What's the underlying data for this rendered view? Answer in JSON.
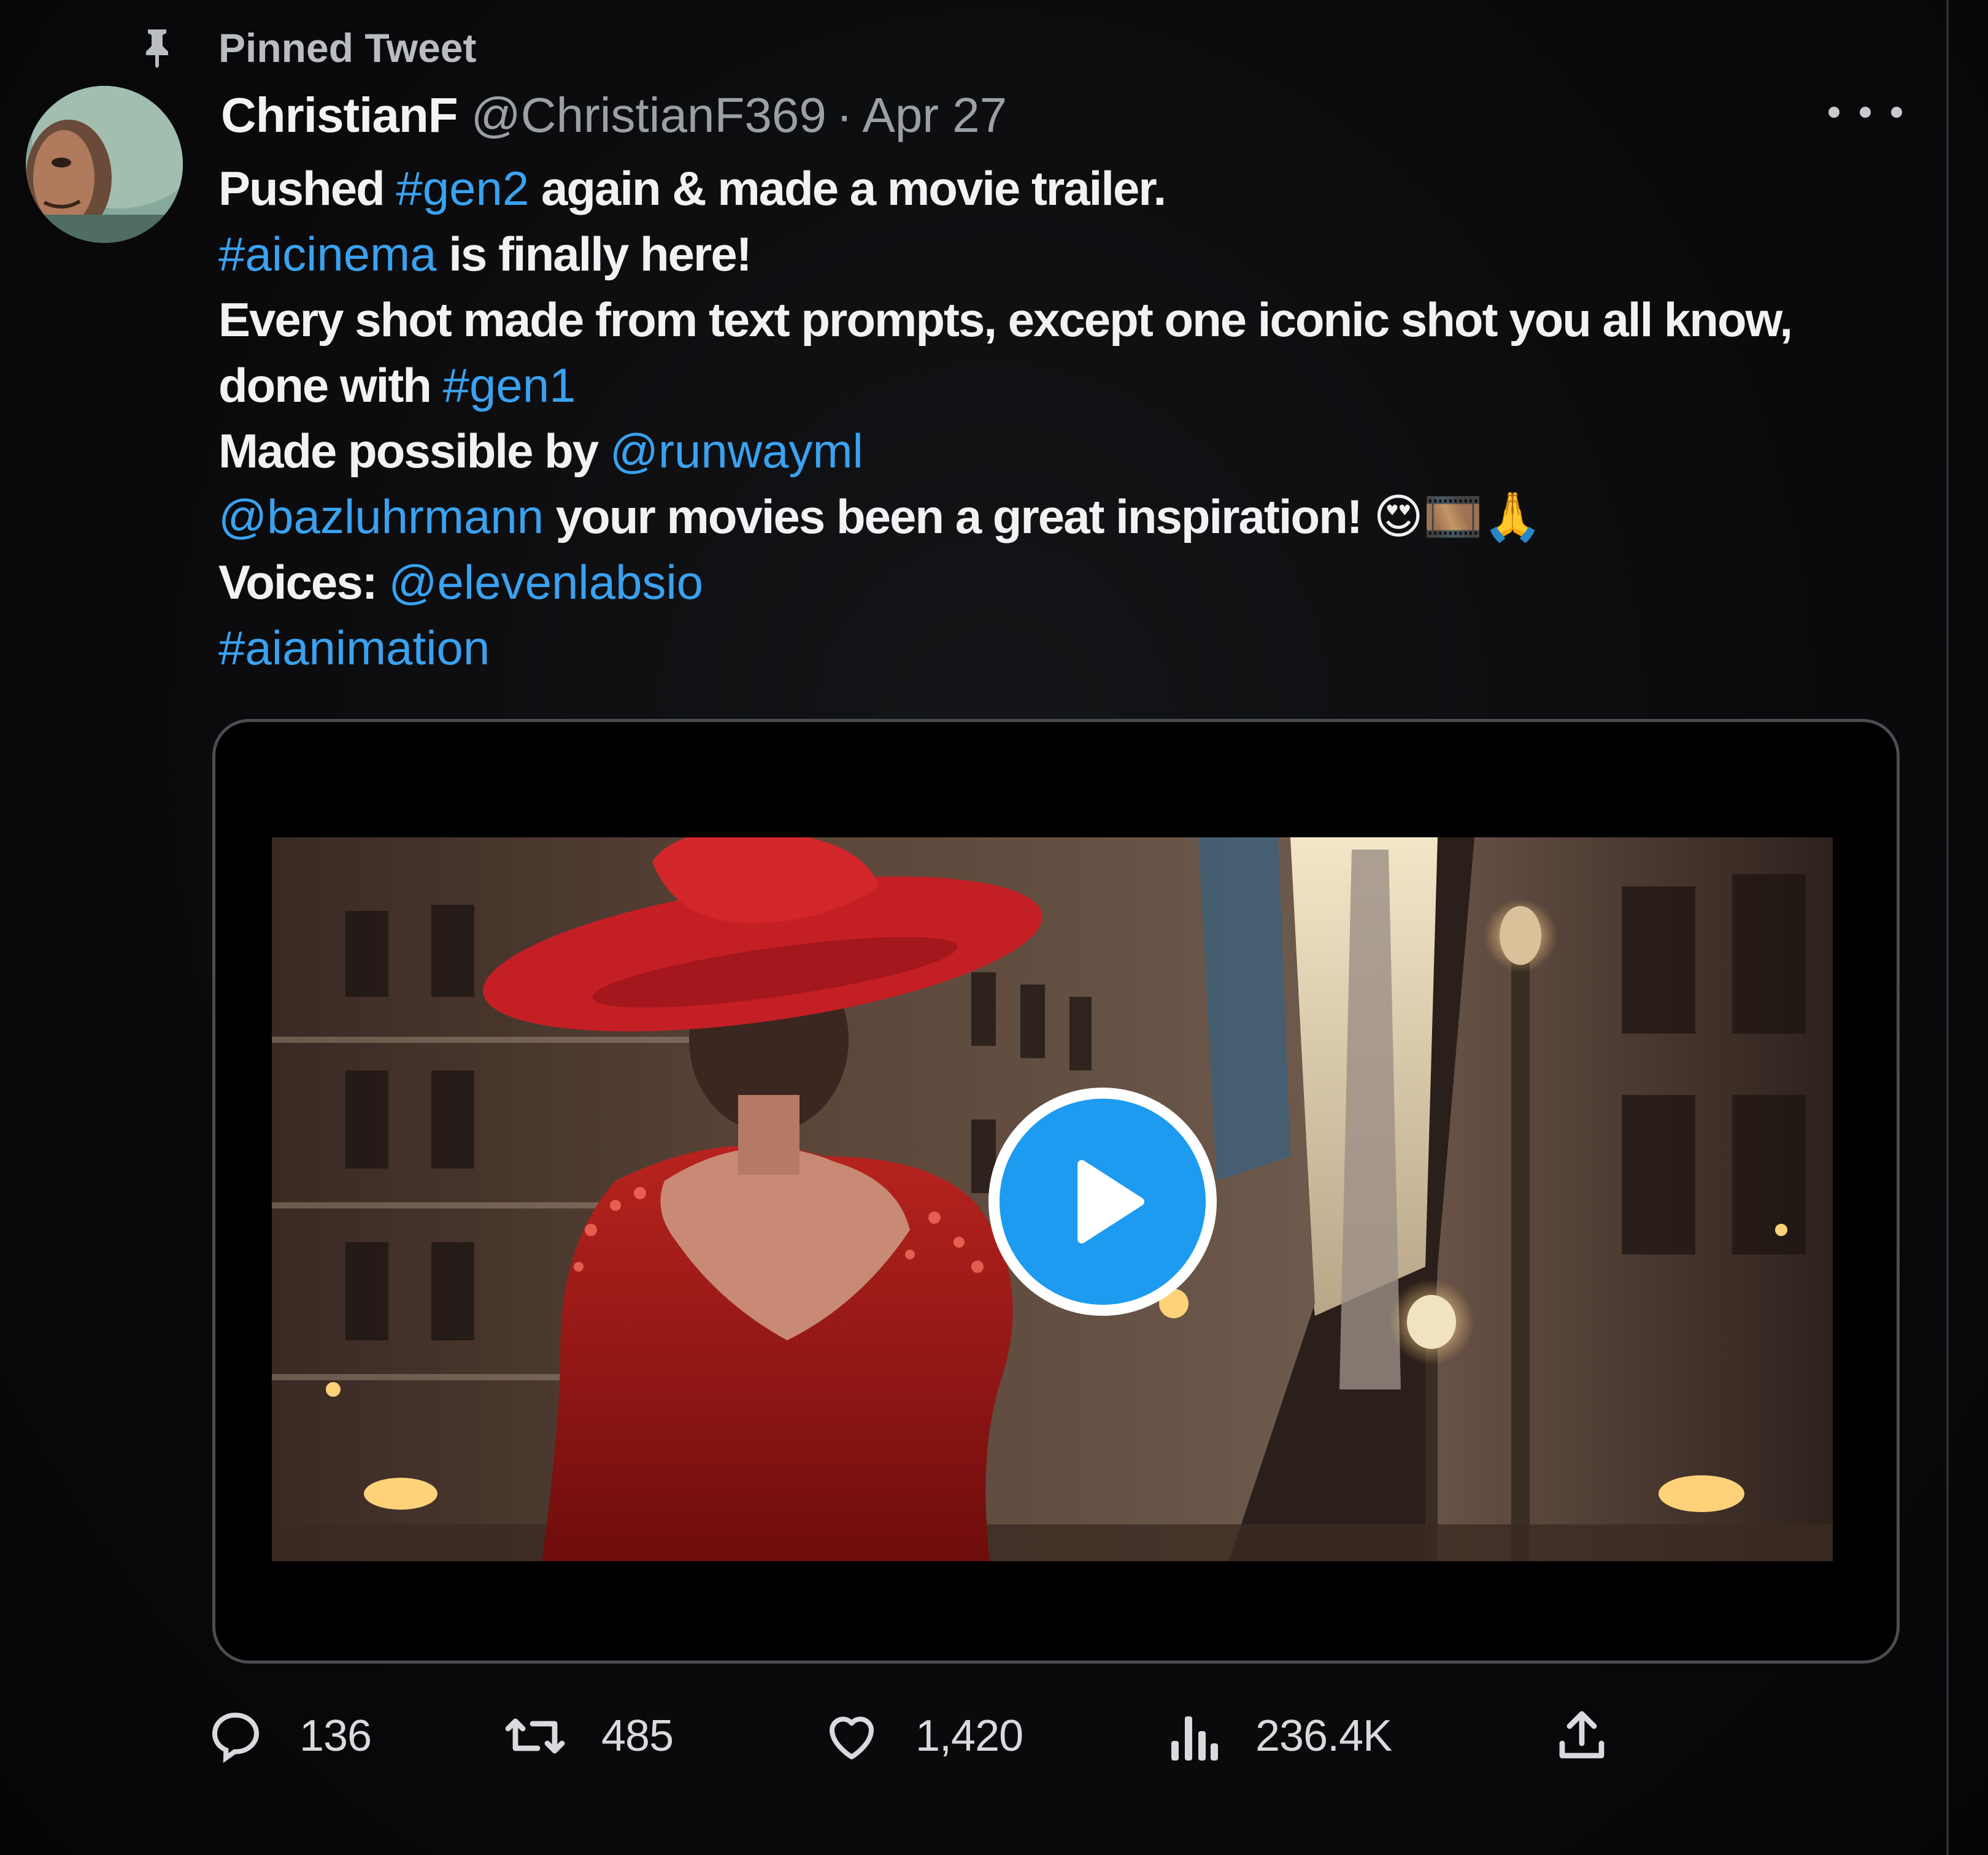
{
  "pinned": {
    "label": "Pinned Tweet"
  },
  "tweet": {
    "display_name": "ChristianF",
    "handle": "@ChristianF369",
    "separator": "·",
    "date": "Apr 27",
    "lines": [
      [
        {
          "t": "Pushed "
        },
        {
          "t": "#gen2",
          "link": true
        },
        {
          "t": " again & made a movie trailer."
        }
      ],
      [
        {
          "t": "#aicinema",
          "link": true
        },
        {
          "t": " is finally here!"
        }
      ],
      [
        {
          "t": "Every shot made from text prompts, except one iconic shot you all know,"
        }
      ],
      [
        {
          "t": "done with "
        },
        {
          "t": "#gen1",
          "link": true
        }
      ],
      [
        {
          "t": "Made possible by "
        },
        {
          "t": "@runwayml",
          "link": true
        }
      ],
      [
        {
          "t": "@bazluhrmann",
          "link": true
        },
        {
          "t": " your movies been a great inspiration! "
        },
        {
          "t": "😍🎞️🙏",
          "emoji": true
        }
      ],
      [
        {
          "t": "Voices: "
        },
        {
          "t": "@elevenlabsio",
          "link": true
        }
      ],
      [
        {
          "t": "#aianimation",
          "link": true
        }
      ]
    ]
  },
  "actions": {
    "replies": "136",
    "retweets": "485",
    "likes": "1,420",
    "views": "236.4K"
  },
  "icons": {
    "pin": "pin-icon",
    "more": "more-icon",
    "play": "play-icon",
    "reply": "reply-icon",
    "retweet": "retweet-icon",
    "like": "heart-icon",
    "views": "views-icon",
    "share": "share-icon"
  },
  "colors": {
    "background": "#000000",
    "link": "#3aa2f0",
    "play_button": "#1d9bf0",
    "text": "#f1f2f3",
    "muted": "#9aa0a6"
  }
}
